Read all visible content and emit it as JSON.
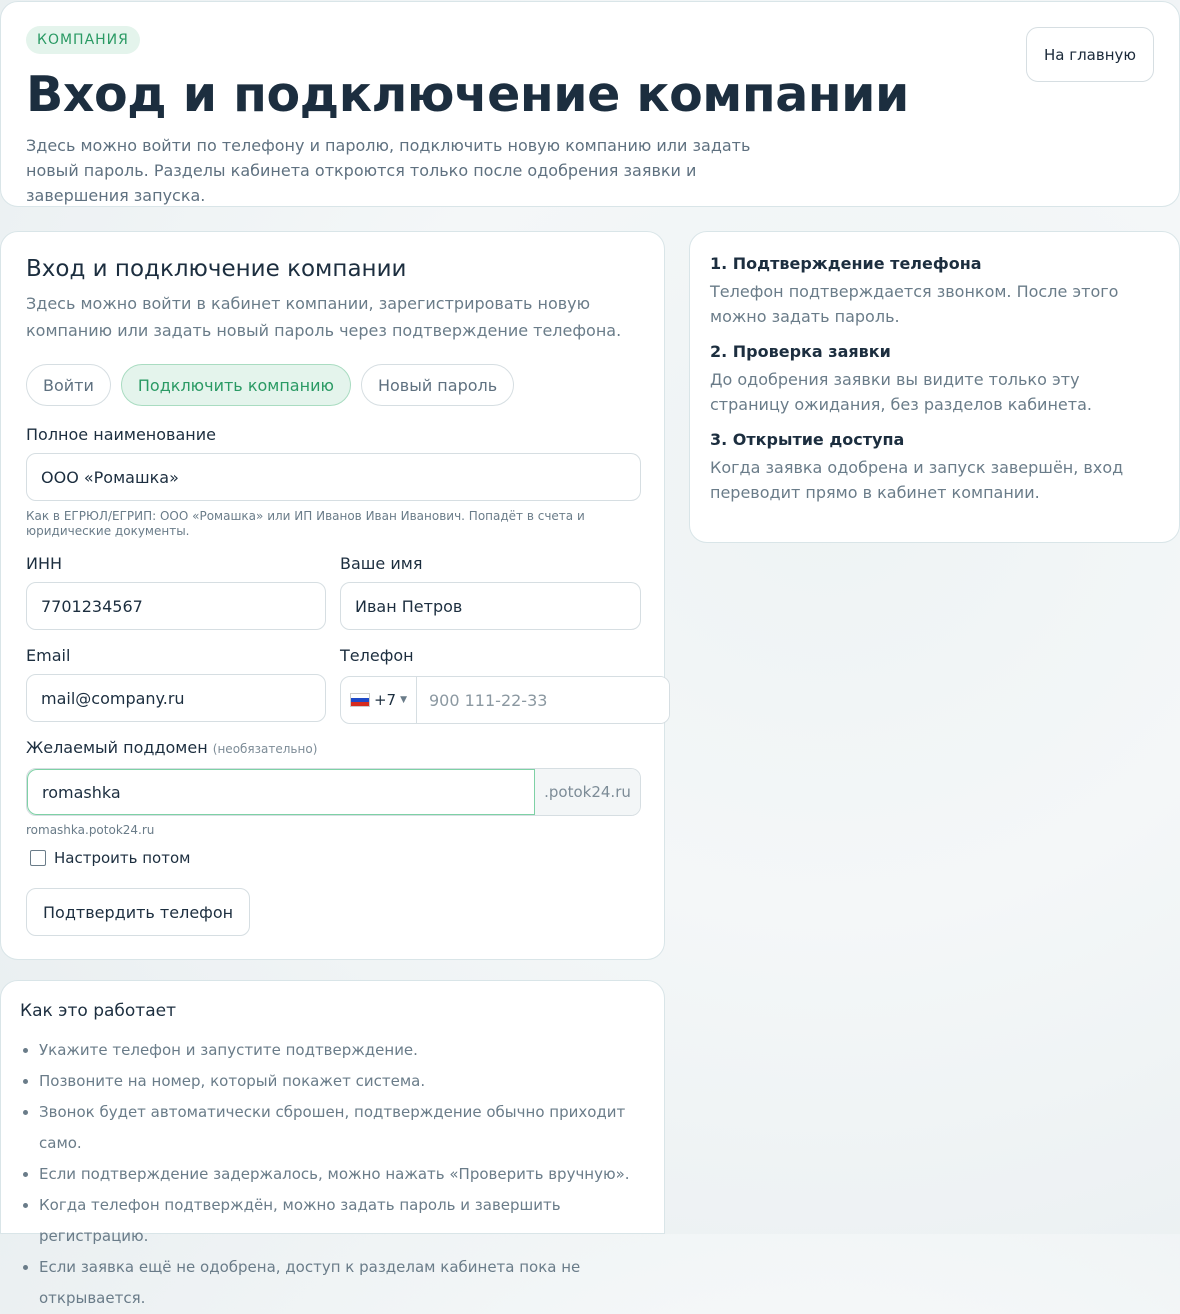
{
  "hero": {
    "badge": "КОМПАНИЯ",
    "title": "Вход и подключение компании",
    "description": "Здесь можно войти по телефону и паролю, подключить новую компанию или задать новый пароль. Разделы кабинета откроются только после одобрения заявки и завершения запуска.",
    "home_button": "На главную"
  },
  "form": {
    "title": "Вход и подключение компании",
    "intro": "Здесь можно войти в кабинет компании, зарегистрировать новую компанию или задать новый пароль через подтверждение телефона.",
    "tabs": [
      {
        "label": "Войти",
        "active": false
      },
      {
        "label": "Подключить компанию",
        "active": true
      },
      {
        "label": "Новый пароль",
        "active": false
      }
    ],
    "full_name": {
      "label": "Полное наименование",
      "value": "ООО «Ромашка»",
      "hint": "Как в ЕГРЮЛ/ЕГРИП: ООО «Ромашка» или ИП Иванов Иван Иванович. Попадёт в счета и юридические документы."
    },
    "inn": {
      "label": "ИНН",
      "value": "7701234567"
    },
    "your_name": {
      "label": "Ваше имя",
      "value": "Иван Петров"
    },
    "email": {
      "label": "Email",
      "value": "mail@company.ru"
    },
    "phone": {
      "label": "Телефон",
      "country_code": "+7",
      "placeholder": "900 111-22-33",
      "flag_icon": "russia-flag-icon"
    },
    "subdomain": {
      "label": "Желаемый поддомен",
      "optional": "(необязательно)",
      "value": "romashka",
      "suffix": ".potok24.ru",
      "preview": "romashka.potok24.ru"
    },
    "setup_later": {
      "label": "Настроить потом",
      "checked": false
    },
    "confirm_button": "Подтвердить телефон"
  },
  "steps": [
    {
      "title": "1. Подтверждение телефона",
      "text": "Телефон подтверждается звонком. После этого можно задать пароль."
    },
    {
      "title": "2. Проверка заявки",
      "text": "До одобрения заявки вы видите только эту страницу ожидания, без разделов кабинета."
    },
    {
      "title": "3. Открытие доступа",
      "text": "Когда заявка одобрена и запуск завершён, вход переводит прямо в кабинет компании."
    }
  ],
  "how_it_works": {
    "title": "Как это работает",
    "items": [
      "Укажите телефон и запустите подтверждение.",
      "Позвоните на номер, который покажет система.",
      "Звонок будет автоматически сброшен, подтверждение обычно приходит само.",
      "Если подтверждение задержалось, можно нажать «Проверить вручную».",
      "Когда телефон подтверждён, можно задать пароль и завершить регистрацию.",
      "Если заявка ещё не одобрена, доступ к разделам кабинета пока не открывается."
    ]
  },
  "colors": {
    "accent": "#2a9a64",
    "accent_bg": "#e4f4ec",
    "text": "#1c2e3f",
    "muted": "#6a7c89"
  }
}
